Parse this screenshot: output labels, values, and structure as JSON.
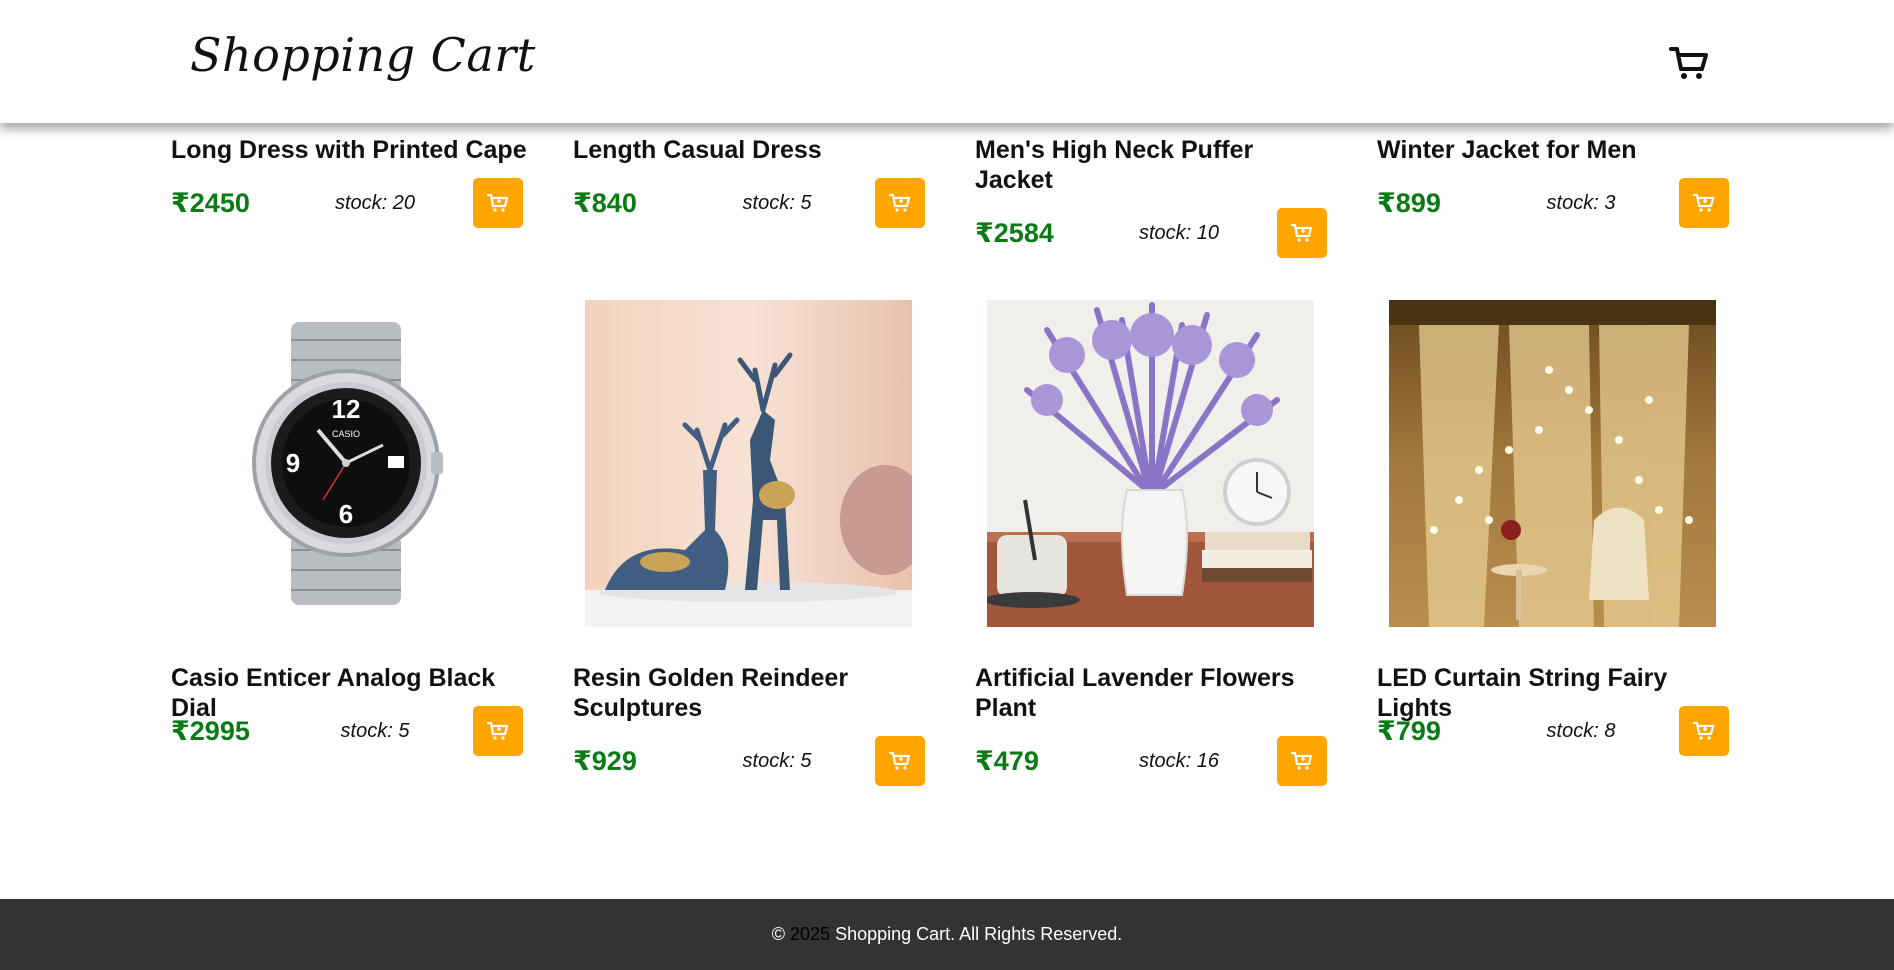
{
  "header": {
    "logo": "Shopping Cart",
    "cart_icon": "cart-icon"
  },
  "colors": {
    "accent": "#ffa500",
    "price": "#0a7a16",
    "footer_bg": "#333333"
  },
  "products_row1": [
    {
      "title": "Long Dress with Printed Cape",
      "price": "₹2450",
      "stock": "stock: 20"
    },
    {
      "title": "Length Casual Dress",
      "price": "₹840",
      "stock": "stock: 5"
    },
    {
      "title": "Men's High Neck Puffer Jacket",
      "price": "₹2584",
      "stock": "stock: 10"
    },
    {
      "title": "Winter Jacket for Men",
      "price": "₹899",
      "stock": "stock: 3"
    }
  ],
  "products_row2": [
    {
      "title": "Casio Enticer Analog Black Dial",
      "price": "₹2995",
      "stock": "stock: 5",
      "image": "wristwatch-image"
    },
    {
      "title": "Resin Golden Reindeer Sculptures",
      "price": "₹929",
      "stock": "stock: 5",
      "image": "reindeer-sculpture-image"
    },
    {
      "title": "Artificial Lavender Flowers Plant",
      "price": "₹479",
      "stock": "stock: 16",
      "image": "lavender-vase-image"
    },
    {
      "title": "LED Curtain String Fairy Lights",
      "price": "₹799",
      "stock": "stock: 8",
      "image": "fairy-lights-curtain-image"
    }
  ],
  "footer": {
    "copyright": "©",
    "year": "2025",
    "text": "Shopping Cart. All Rights Reserved."
  }
}
